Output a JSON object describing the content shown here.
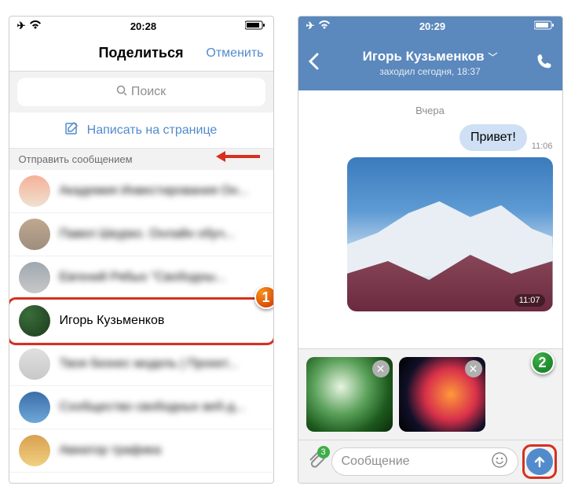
{
  "left": {
    "status": {
      "time": "20:28"
    },
    "header": {
      "title": "Поделиться",
      "cancel": "Отменить"
    },
    "search": {
      "placeholder": "Поиск"
    },
    "write_on_wall": "Написать на странице",
    "section_send_msg": "Отправить сообщением",
    "contacts": [
      {
        "name": "Академия Инвестирования Он..."
      },
      {
        "name": "Павел Шкурко. Онлайн обуч..."
      },
      {
        "name": "Евгений Рябых \"Свободны..."
      },
      {
        "name": "Игорь Кузьменков"
      },
      {
        "name": "Твоя бизнес модель | Проект..."
      },
      {
        "name": "Сообщество свободных веб-д..."
      },
      {
        "name": "Авиатор трафика"
      }
    ],
    "highlight_index": 3,
    "badge1": "1"
  },
  "right": {
    "status": {
      "time": "20:29"
    },
    "header": {
      "name": "Игорь Кузьменков",
      "last_seen": "заходил сегодня, 18:37"
    },
    "day_label": "Вчера",
    "messages": {
      "text": "Привет!",
      "text_time": "11:06",
      "image_time": "11:07"
    },
    "input": {
      "attach_count": "3",
      "placeholder": "Сообщение"
    },
    "badge2": "2"
  }
}
